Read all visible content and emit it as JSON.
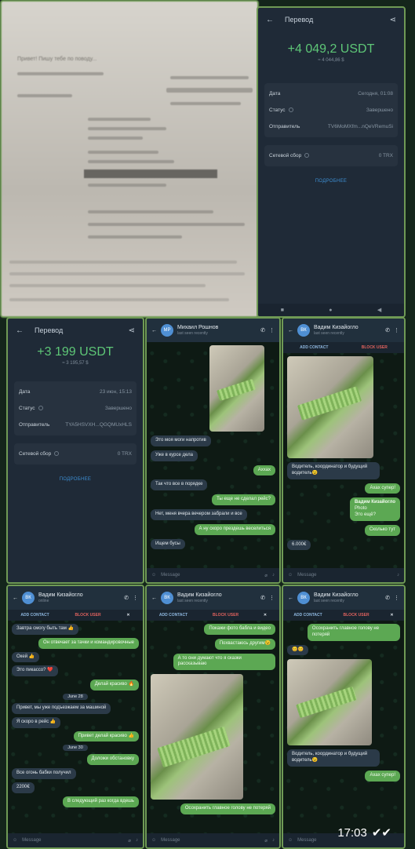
{
  "transfer1": {
    "title": "Перевод",
    "amount": "+4 049,2 USDT",
    "fiat": "≈ 4 044,86 $",
    "rows": [
      {
        "label": "Дата",
        "value": "Сегодня, 01:08"
      },
      {
        "label": "Статус",
        "value": "Завершено"
      },
      {
        "label": "Отправитель",
        "value": "TV6MoMXfm...nQeVRemuSi"
      }
    ],
    "fee_label": "Сетевой сбор",
    "fee_value": "0 TRX",
    "details": "ПОДРОБНЕЕ"
  },
  "transfer2": {
    "title": "Перевод",
    "amount": "+3 199 USDT",
    "fiat": "≈ 3 195,57 $",
    "rows": [
      {
        "label": "Дата",
        "value": "23 июн, 15:13"
      },
      {
        "label": "Статус",
        "value": "Завершено"
      },
      {
        "label": "Отправитель",
        "value": "TYA5HSVXH...QGQMUxHLS"
      }
    ],
    "fee_label": "Сетевой сбор",
    "fee_value": "0 TRX",
    "details": "ПОДРОБНЕЕ"
  },
  "chat_mid": {
    "name": "Михаил Рошнов",
    "status": "last seen recently",
    "messages": [
      "Это моя моги напротив",
      "Уже в курсе дела",
      "Аххах",
      "Так что все в порядке",
      "Ты еще не сделал рейс?",
      "Нет, меня вчера вечером забрали и все",
      "А ну скоро прездешь веселиться",
      "Ищем бусы"
    ],
    "composer": "Message"
  },
  "chat_right": {
    "name": "Вадим Кизайогло",
    "status": "last seen recently",
    "add": "ADD CONTACT",
    "block": "BLOCK USER",
    "messages": [
      "Водитель, координатор и будущий водитель😉",
      "Ахах супер!",
      "Вадим Кизайогло",
      "Photo",
      "Это ещё?",
      "Сколько тут",
      "6.000€"
    ],
    "composer": "Message"
  },
  "chat_bl": {
    "name": "Вадим Кизайогло",
    "status": "online",
    "add": "ADD CONTACT",
    "block": "BLOCK USER",
    "messages": [
      "Завтра смогу быть там 👍",
      "Он отвечает за тачки и командировочные",
      "Окей 👍",
      "Это пикассо? ❤️",
      "Делай красиво 🔥",
      "June 28",
      "Привет, мы уже подъезжаем за машиной",
      "Я скоро в рейс 👍",
      "Привет делай красиво 👍",
      "June 30",
      "Доложи обстановку",
      "Все огонь бабки получил",
      "2200€",
      "В следующий раз когда вдешь"
    ],
    "composer": "Message"
  },
  "chat_bm": {
    "name": "Вадим Кизайогло",
    "status": "last seen recently",
    "add": "ADD CONTACT",
    "block": "BLOCK USER",
    "messages": [
      "Покажи фото бабла и видео",
      "Похвастаюсь другим😉",
      "А то они думают что я сказки рассказываю",
      "Осохранить главное голову не потеряй"
    ],
    "composer": "Message"
  },
  "chat_br": {
    "name": "Вадим Кизайогло",
    "status": "last seen recently",
    "add": "ADD CONTACT",
    "block": "BLOCK USER",
    "messages": [
      "Осохранить главное голову не потеряй",
      "😊😊",
      "Водитель, координатор и будущий водитель😉",
      "Ахах супер!"
    ],
    "composer": "Message"
  },
  "overlay": {
    "time": "17:03"
  }
}
